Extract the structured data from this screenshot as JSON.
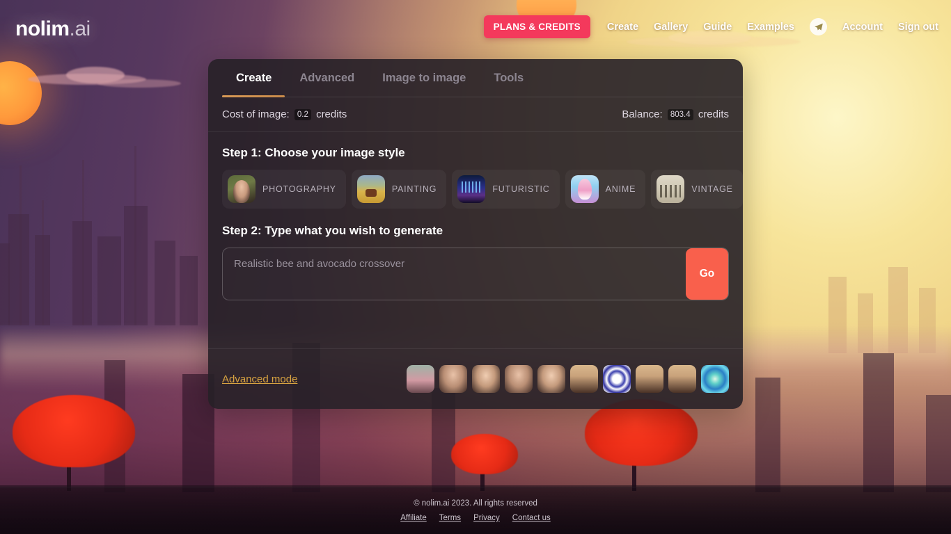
{
  "brand": {
    "name_bold": "nolim",
    "name_light": ".ai"
  },
  "nav": {
    "plans_label": "PLANS & CREDITS",
    "links": [
      {
        "label": "Create"
      },
      {
        "label": "Gallery"
      },
      {
        "label": "Guide"
      },
      {
        "label": "Examples"
      }
    ],
    "telegram_icon": "telegram-icon",
    "account_label": "Account",
    "signout_label": "Sign out"
  },
  "panel": {
    "tabs": [
      {
        "label": "Create",
        "active": true
      },
      {
        "label": "Advanced",
        "active": false
      },
      {
        "label": "Image to image",
        "active": false
      },
      {
        "label": "Tools",
        "active": false
      }
    ],
    "cost": {
      "prefix": "Cost of image:",
      "value": "0.2",
      "suffix": "credits"
    },
    "balance": {
      "prefix": "Balance:",
      "value": "803.4",
      "suffix": "credits"
    },
    "step1": {
      "title": "Step 1: Choose your image style",
      "styles": [
        {
          "label": "PHOTOGRAPHY",
          "thumb": "photography-thumb"
        },
        {
          "label": "PAINTING",
          "thumb": "painting-thumb"
        },
        {
          "label": "FUTURISTIC",
          "thumb": "futuristic-thumb"
        },
        {
          "label": "ANIME",
          "thumb": "anime-thumb"
        },
        {
          "label": "VINTAGE",
          "thumb": "vintage-thumb"
        }
      ]
    },
    "step2": {
      "title": "Step 2: Type what you wish to generate",
      "placeholder": "Realistic bee and avocado crossover",
      "value": "",
      "go_label": "Go"
    },
    "advanced_mode_label": "Advanced mode",
    "gallery": [
      {
        "name": "gallery-thumb-1"
      },
      {
        "name": "gallery-thumb-2"
      },
      {
        "name": "gallery-thumb-3"
      },
      {
        "name": "gallery-thumb-4"
      },
      {
        "name": "gallery-thumb-5"
      },
      {
        "name": "gallery-thumb-6"
      },
      {
        "name": "gallery-thumb-7"
      },
      {
        "name": "gallery-thumb-8"
      },
      {
        "name": "gallery-thumb-9"
      },
      {
        "name": "gallery-thumb-10"
      }
    ]
  },
  "footer": {
    "copyright": "© nolim.ai 2023. All rights reserved",
    "links": [
      {
        "label": "Affiliate"
      },
      {
        "label": "Terms"
      },
      {
        "label": "Privacy"
      },
      {
        "label": "Contact us"
      }
    ]
  },
  "colors": {
    "accent_pink": "#f4395c",
    "accent_orange": "#f9604c",
    "tab_underline": "#d89a56",
    "advanced_link": "#d9a441",
    "panel_bg": "rgba(38,32,39,0.90)"
  }
}
